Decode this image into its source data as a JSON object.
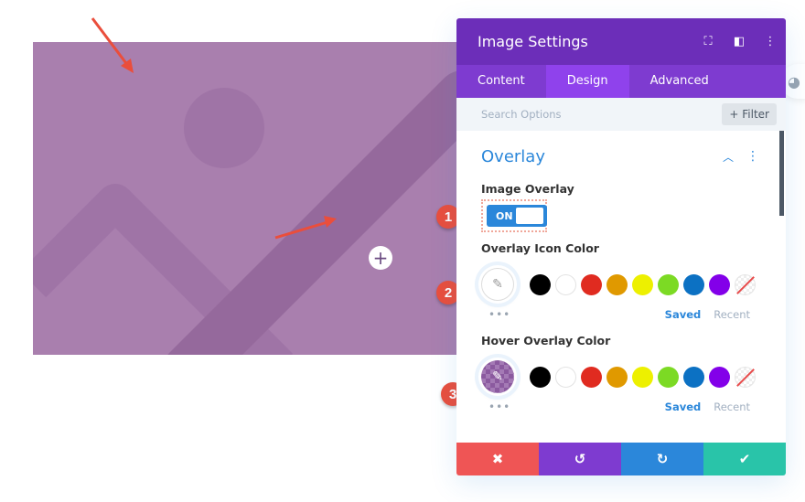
{
  "panel": {
    "title": "Image Settings",
    "header_icons": [
      "expand-icon",
      "split-view-icon",
      "more-options-icon"
    ],
    "tabs": [
      {
        "label": "Content",
        "active": false
      },
      {
        "label": "Design",
        "active": true
      },
      {
        "label": "Advanced",
        "active": false
      }
    ],
    "search": {
      "placeholder": "Search Options",
      "filter_label": "+ Filter"
    },
    "section": {
      "title": "Overlay",
      "collapse_icon": "chevron-up-icon"
    },
    "image_overlay": {
      "label": "Image Overlay",
      "toggle_label": "ON",
      "value": true
    },
    "overlay_icon_color": {
      "label": "Overlay Icon Color",
      "saved_label": "Saved",
      "recent_label": "Recent",
      "more": "•••"
    },
    "hover_overlay_color": {
      "label": "Hover Overlay Color",
      "saved_label": "Saved",
      "recent_label": "Recent",
      "more": "•••"
    },
    "swatches": [
      "#000000",
      "#ffffff",
      "#e02b20",
      "#e09900",
      "#edf000",
      "#7cda24",
      "#0c71c3",
      "#8300e9",
      "none"
    ],
    "footer": {
      "cancel": {
        "icon": "✖",
        "color": "#ef5555"
      },
      "undo": {
        "icon": "↺",
        "color": "#7e3bd0"
      },
      "redo": {
        "icon": "↻",
        "color": "#2b87da"
      },
      "save": {
        "icon": "✔",
        "color": "#29c4a9"
      }
    }
  },
  "badges": [
    "1",
    "2",
    "3"
  ],
  "canvas": {
    "add_icon": "+",
    "overlay_color": "#a97fae"
  }
}
